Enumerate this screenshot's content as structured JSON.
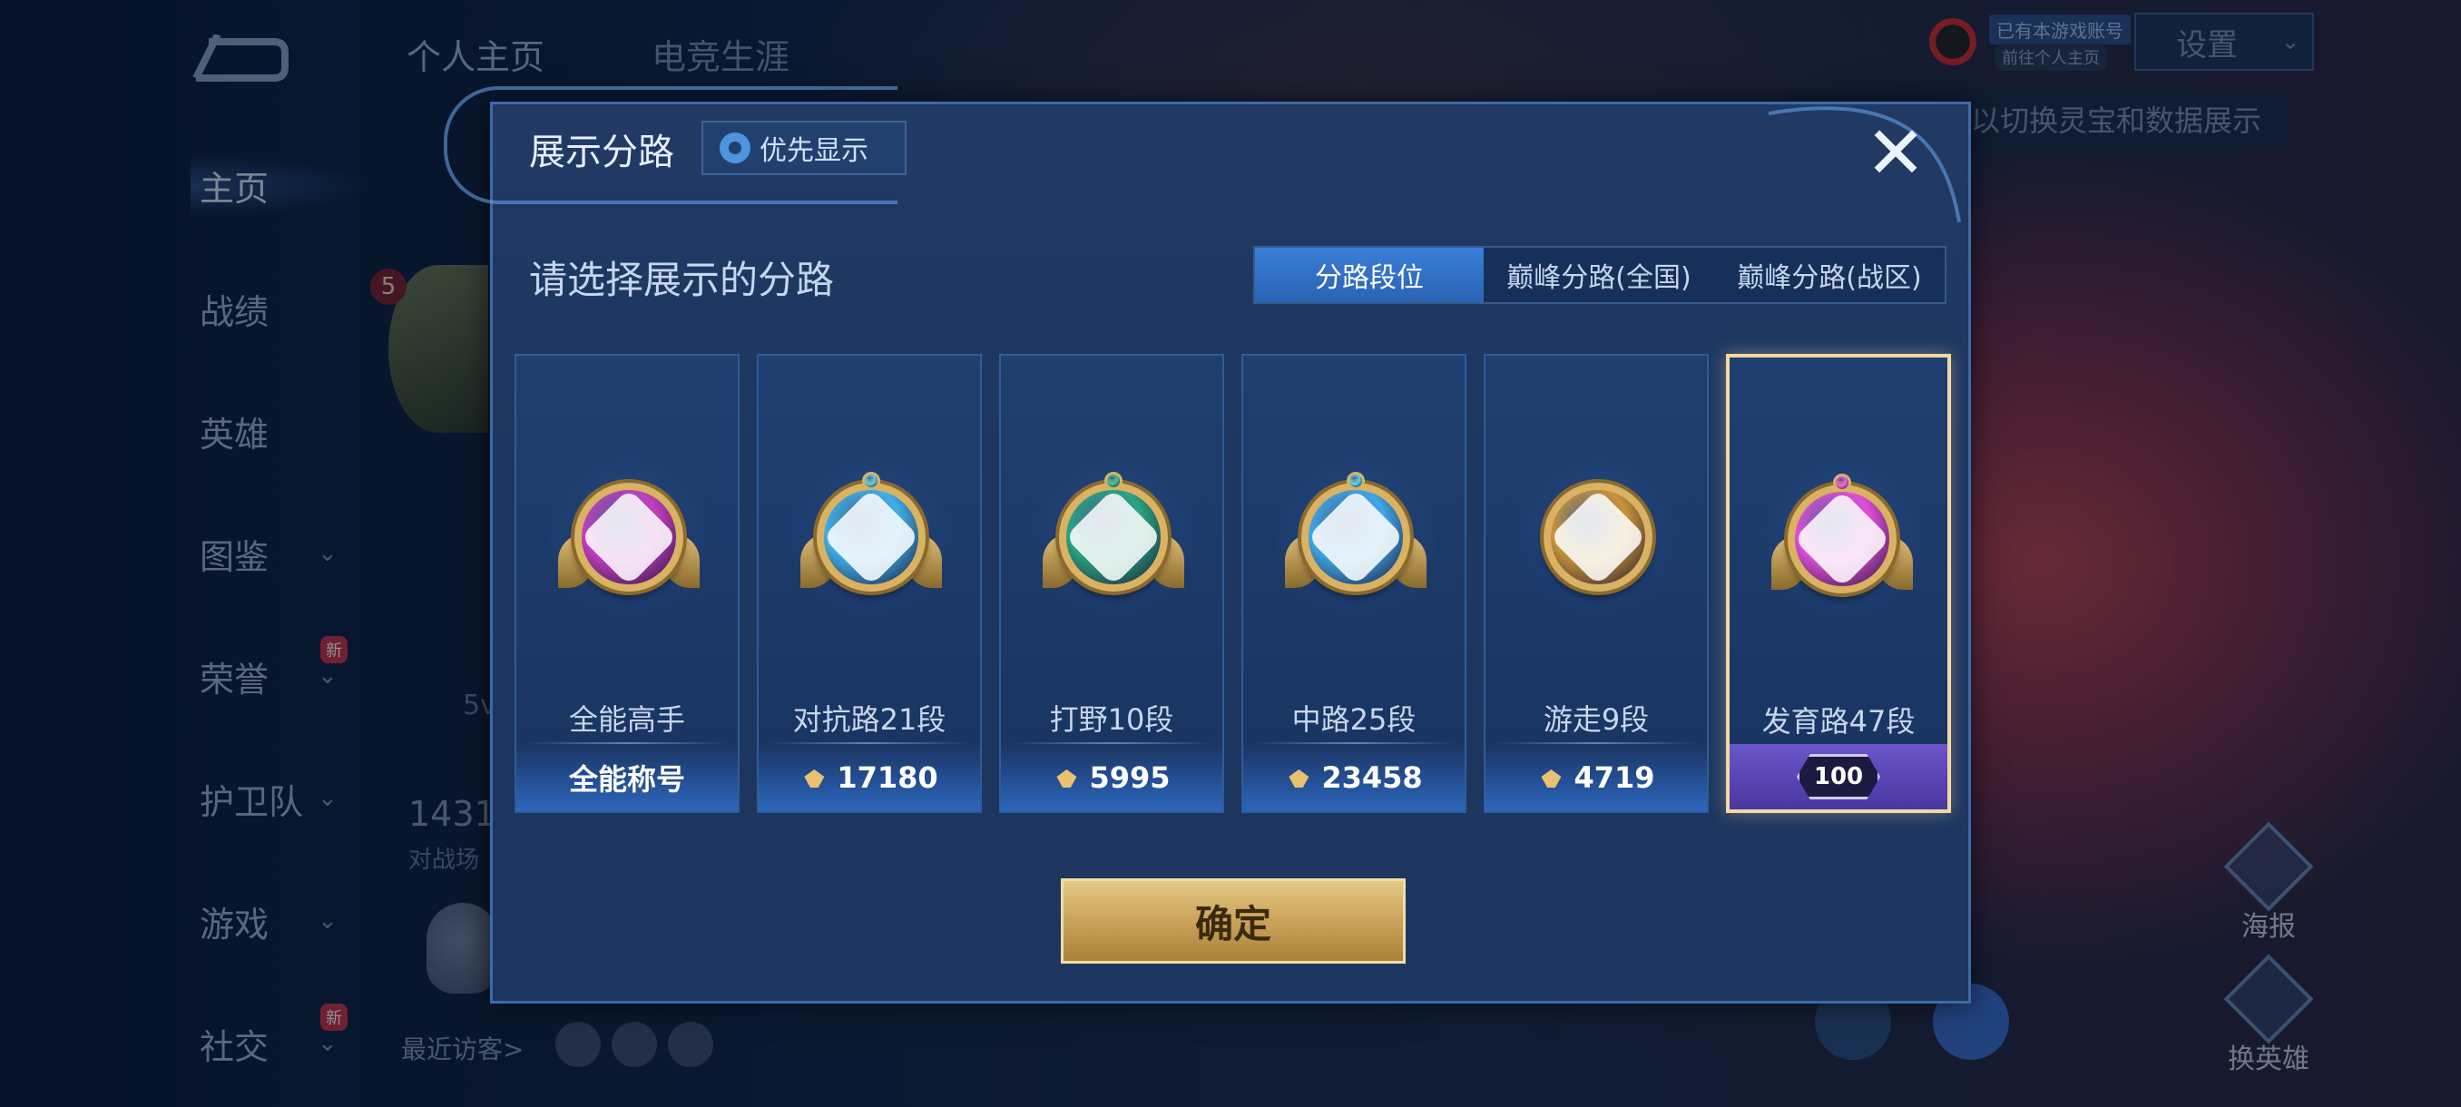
{
  "background": {
    "sidebar": {
      "items": [
        {
          "label": "主页",
          "active": true
        },
        {
          "label": "战绩"
        },
        {
          "label": "英雄"
        },
        {
          "label": "图鉴",
          "expandable": true
        },
        {
          "label": "荣誉",
          "expandable": true,
          "new_badge": "新"
        },
        {
          "label": "护卫队",
          "expandable": true
        },
        {
          "label": "游戏",
          "expandable": true
        },
        {
          "label": "社交",
          "expandable": true,
          "new_badge": "新"
        }
      ]
    },
    "header_tabs": [
      "个人主页",
      "电竞生涯"
    ],
    "profile": {
      "level_badge": "5",
      "partial_text": "5v",
      "stat_value": "1431",
      "stat_label": "对战场",
      "recent_visitors_label": "最近访客>"
    },
    "top_right": {
      "tag1": "已有本游戏账号",
      "tag2": "前往个人主页",
      "select_label": "设置",
      "tooltip": "以切换灵宝和数据展示"
    },
    "side_buttons": [
      "海报",
      "换英雄"
    ]
  },
  "modal": {
    "title": "展示分路",
    "priority_button": "优先显示",
    "subtitle": "请选择展示的分路",
    "tabs": [
      "分路段位",
      "巅峰分路(全国)",
      "巅峰分路(战区)"
    ],
    "active_tab": 0,
    "cards": [
      {
        "name": "全能高手",
        "footer": "全能称号",
        "emblem_color": "#c23fc0",
        "cap_color": "#c23fc0"
      },
      {
        "name": "对抗路21段",
        "points": "17180",
        "emblem_color": "#3fb0e6",
        "cap_color": "#5ad0f0"
      },
      {
        "name": "打野10段",
        "points": "5995",
        "emblem_color": "#2aa483",
        "cap_color": "#39c49a"
      },
      {
        "name": "中路25段",
        "points": "23458",
        "emblem_color": "#3fa8e6",
        "cap_color": "#5ad0f0"
      },
      {
        "name": "游走9段",
        "points": "4719",
        "emblem_color": "#c9943a",
        "cap_color": "#e2b868"
      },
      {
        "name": "发育路47段",
        "badge": "100",
        "emblem_color": "#e04fd8",
        "cap_color": "#e860e0",
        "selected": true
      }
    ],
    "confirm_label": "确定",
    "close_icon": "close-icon"
  }
}
